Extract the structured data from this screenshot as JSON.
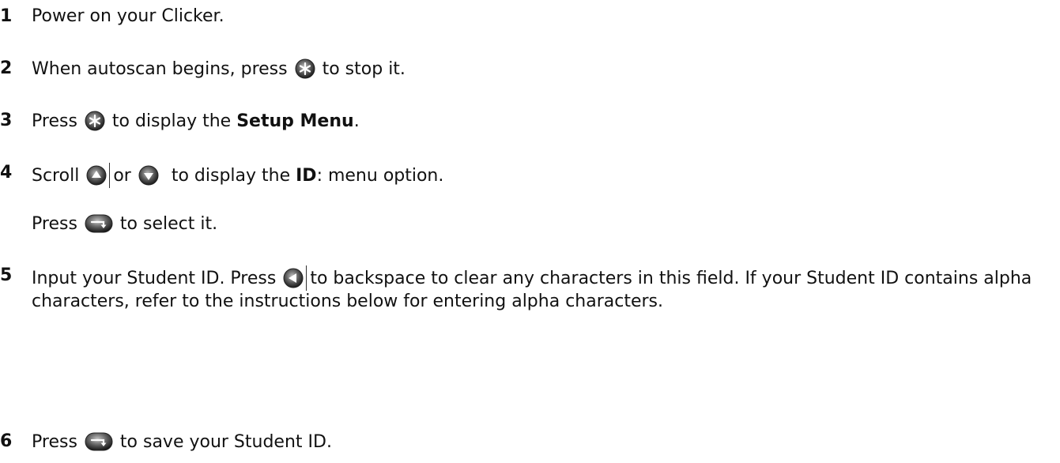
{
  "steps": [
    {
      "number": "1",
      "text": "Power on your Clicker."
    },
    {
      "number": "2",
      "before": "When autoscan begins, press ",
      "icon": "star-button-icon",
      "after": " to stop it."
    },
    {
      "number": "3",
      "before": "Press ",
      "icon": "star-button-icon",
      "middle": " to display the ",
      "bold": "Setup Menu",
      "after": "."
    },
    {
      "number": "4",
      "before": "Scroll ",
      "icon_up": "up-arrow-button-icon",
      "or": "or",
      "icon_down": "down-arrow-button-icon",
      "middle": " to display the ",
      "bold": "ID",
      "after": ": menu option.",
      "sub": {
        "before": "Press ",
        "icon": "enter-button-icon",
        "after": " to select it."
      }
    },
    {
      "number": "5",
      "before": "Input your Student ID. Press ",
      "icon": "back-arrow-button-icon",
      "after": "to backspace to clear any characters in this field. If your Student ID contains alpha characters, refer to the instructions below for entering alpha characters."
    },
    {
      "number": "6",
      "before": "Press ",
      "icon": "enter-button-icon",
      "after": " to save your Student ID."
    }
  ]
}
